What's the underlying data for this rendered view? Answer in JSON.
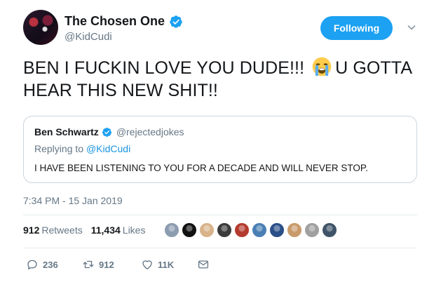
{
  "author": {
    "display_name": "The Chosen One",
    "handle": "@KidCudi",
    "verified": true
  },
  "follow_button": {
    "label": "Following"
  },
  "tweet_text": {
    "part1": "BEN I FUCKIN LOVE YOU DUDE!!!",
    "emoji": "loudly-crying-face",
    "part2": "U GOTTA HEAR THIS NEW SHIT!!"
  },
  "quoted_tweet": {
    "display_name": "Ben Schwartz",
    "handle": "@rejectedjokes",
    "verified": true,
    "replying_prefix": "Replying to",
    "replying_handle": "@KidCudi",
    "text": "I HAVE BEEN LISTENING TO YOU FOR A DECADE AND WILL NEVER STOP."
  },
  "timestamp": "7:34 PM - 15 Jan 2019",
  "stats": {
    "retweets_count": "912",
    "retweets_label": "Retweets",
    "likes_count": "11,434",
    "likes_label": "Likes"
  },
  "liker_avatars": [
    "#8b9bb0",
    "#111111",
    "#d9b38a",
    "#3b3b3b",
    "#b33a2e",
    "#4a7fb5",
    "#2b4f88",
    "#c99a6b",
    "#a0a0a0",
    "#3f5468"
  ],
  "actions": {
    "reply_count": "236",
    "retweet_count": "912",
    "like_count": "11K"
  },
  "colors": {
    "accent": "#1da1f2",
    "text_secondary": "#657786",
    "border": "#ccd6dd"
  }
}
